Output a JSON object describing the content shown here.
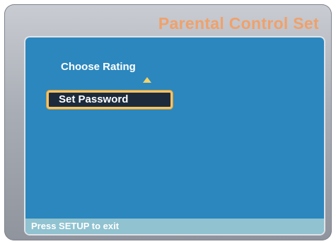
{
  "header": {
    "title": "Parental Control Set"
  },
  "menu": {
    "items": [
      {
        "label": "Choose Rating",
        "selected": false
      },
      {
        "label": "Set Password",
        "selected": true
      }
    ],
    "scroll_indicator": "arrow-up-icon"
  },
  "status_bar": {
    "text": "Press SETUP to exit"
  },
  "colors": {
    "frame": "#a9adb5",
    "title": "#f0a16b",
    "screen_bg": "#2b87be",
    "highlight_border": "#f2c36b",
    "highlight_bg": "#1c2a3c",
    "status_bar_bg": "#90c2d0"
  }
}
